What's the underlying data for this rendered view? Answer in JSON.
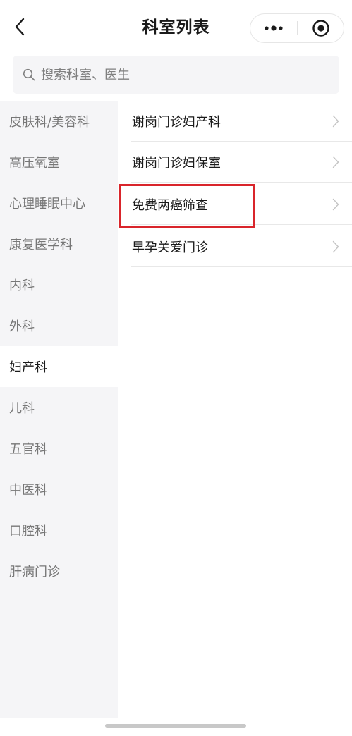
{
  "header": {
    "title": "科室列表",
    "back_icon": "chevron-left-icon",
    "more_icon": "more-dots-icon",
    "close_icon": "target-close-icon"
  },
  "search": {
    "placeholder": "搜索科室、医生",
    "value": ""
  },
  "departments": [
    {
      "label": "皮肤科/美容科",
      "active": false
    },
    {
      "label": "高压氧室",
      "active": false
    },
    {
      "label": "心理睡眠中心",
      "active": false
    },
    {
      "label": "康复医学科",
      "active": false
    },
    {
      "label": "内科",
      "active": false
    },
    {
      "label": "外科",
      "active": false
    },
    {
      "label": "妇产科",
      "active": true
    },
    {
      "label": "儿科",
      "active": false
    },
    {
      "label": "五官科",
      "active": false
    },
    {
      "label": "中医科",
      "active": false
    },
    {
      "label": "口腔科",
      "active": false
    },
    {
      "label": "肝病门诊",
      "active": false
    }
  ],
  "clinics": [
    {
      "label": "谢岗门诊妇产科",
      "highlighted": false
    },
    {
      "label": "谢岗门诊妇保室",
      "highlighted": false
    },
    {
      "label": "免费两癌筛查",
      "highlighted": true
    },
    {
      "label": "早孕关爱门诊",
      "highlighted": false
    }
  ],
  "colors": {
    "highlight": "#d9252b",
    "menu_bg": "#f5f5f7",
    "inactive_text": "#777777"
  }
}
